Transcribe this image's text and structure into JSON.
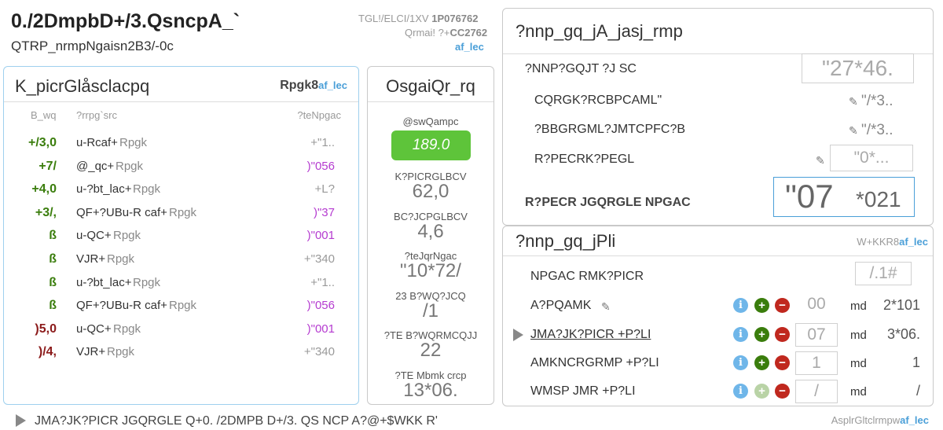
{
  "header": {
    "title": "0./2DmpbD+/3.QsncpA_`",
    "subtitle": "QTRP_nrmpNgaisn2B3/-0c",
    "meta_line1_label": "TGL!/ELCI/1XV",
    "meta_line1_value": "1P076762",
    "meta_line2_label": "Qrmai! ?+",
    "meta_line2_value": "CC2762",
    "meta_link": "af_lec"
  },
  "left_panel": {
    "title": "K_picrGlåsclacpq",
    "right_label": "Rpgk8",
    "right_link": "af_lec",
    "columns": [
      "B_wq",
      "?rrpg`src",
      "?teNpgac"
    ],
    "rows": [
      {
        "amount": "+/3,0",
        "amount_color": "green",
        "name": "u-Rcaf+",
        "tag": "Rpgk",
        "value": "+\"1..",
        "value_color": "gray"
      },
      {
        "amount": "+7/",
        "amount_color": "green",
        "name": "@_qc+",
        "tag": "Rpgk",
        "value": ")\"056",
        "value_color": "magenta"
      },
      {
        "amount": "+4,0",
        "amount_color": "green",
        "name": "u-?bt_lac+",
        "tag": "Rpgk",
        "value": "+L?",
        "value_color": "gray"
      },
      {
        "amount": "+3/,",
        "amount_color": "green",
        "name": "QF+?UBu-R caf+",
        "tag": "Rpgk",
        "value": ")\"37",
        "value_color": "magenta"
      },
      {
        "amount": "ß",
        "amount_color": "green",
        "name": "u-QC+",
        "tag": "Rpgk",
        "value": ")\"001",
        "value_color": "magenta"
      },
      {
        "amount": "ß",
        "amount_color": "green",
        "name": "VJR+",
        "tag": "Rpgk",
        "value": "+\"340",
        "value_color": "gray"
      },
      {
        "amount": "ß",
        "amount_color": "green",
        "name": "u-?bt_lac+",
        "tag": "Rpgk",
        "value": "+\"1..",
        "value_color": "gray"
      },
      {
        "amount": "ß",
        "amount_color": "green",
        "name": "QF+?UBu-R caf+",
        "tag": "Rpgk",
        "value": ")\"056",
        "value_color": "magenta"
      },
      {
        "amount": ")5,0",
        "amount_color": "red",
        "name": "u-QC+",
        "tag": "Rpgk",
        "value": ")\"001",
        "value_color": "magenta"
      },
      {
        "amount": ")/4,",
        "amount_color": "red",
        "name": "VJR+",
        "tag": "Rpgk",
        "value": "+\"340",
        "value_color": "gray"
      }
    ]
  },
  "middle_panel": {
    "title": "OsgaiQr_rq",
    "badge_label": "@swQampc",
    "badge_value": "189.0",
    "stats": [
      {
        "label": "K?PICRGLBCV",
        "value": "62,0"
      },
      {
        "label": "BC?JCPGLBCV",
        "value": "4,6"
      },
      {
        "label": "?teJqrNgac",
        "value": "\"10*72/"
      },
      {
        "label": "23 B?WQ?JCQ",
        "value": "/1"
      },
      {
        "label": "?TE B?WQRMCQJJ",
        "value": "22"
      },
      {
        "label": "?TE Mbmk crcp",
        "value": "13*06."
      }
    ]
  },
  "right_top": {
    "title": "?nnp_gq_jA_jasj_rmp",
    "rows": [
      {
        "label": "?NNP?GQJT ?J SC",
        "value": "\"27*46.",
        "type": "input"
      },
      {
        "label": "CQRGK?RCBPCAML\"",
        "value": "\"/*3..",
        "type": "edit"
      },
      {
        "label": "?BBGRGML?JMTCPFC?B",
        "value": "\"/*3..",
        "type": "edit"
      },
      {
        "label": "R?PECRK?PEGL",
        "value": "\"0*...",
        "type": "edit-input"
      }
    ],
    "total_label": "R?PECR JGQRGLE NPGAC",
    "total_value_big": "\"07",
    "total_value_small": "*021"
  },
  "right_bottom": {
    "title": "?nnp_gq_jPli",
    "right_label": "W+KKR8",
    "right_link": "af_lec",
    "rows": [
      {
        "label": "NPGAC RMK?PICR",
        "value": "/.1#",
        "type": "input-only"
      },
      {
        "label": "A?PQAMK",
        "qty": "00",
        "unit": "md",
        "price": "2*101",
        "pencil": true,
        "plus_dim": false,
        "qty_box": false
      },
      {
        "label": "JMA?JK?PICR +P?LI",
        "qty": "07",
        "unit": "md",
        "price": "3*06.",
        "selected": true,
        "plus_dim": false,
        "qty_box": true
      },
      {
        "label": "AMKNCRGRMP +P?LI",
        "qty": "1",
        "unit": "md",
        "price": "1",
        "plus_dim": false,
        "qty_box": true
      },
      {
        "label": "WMSP JMR +P?LI",
        "qty": "/",
        "unit": "md",
        "price": "/",
        "plus_dim": true,
        "qty_box": true
      }
    ],
    "footer_label": "AsplrGltclrmpw",
    "footer_link": "af_lec"
  },
  "footer": {
    "text": "JMA?JK?PICR JGQRGLE Q+0. /2DMPB D+/3. QS NCP A?@+$WKK R'"
  },
  "colors": {
    "accent": "#4a9fd8",
    "green_button": "#5ec43a",
    "positive": "#3a7d0c",
    "negative": "#8b1a1a",
    "magenta": "#b53bd0"
  }
}
